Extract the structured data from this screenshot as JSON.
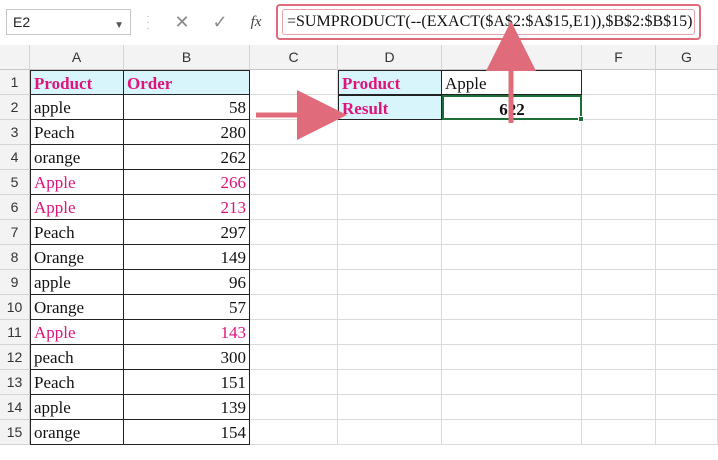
{
  "name_box": "E2",
  "formula": "=SUMPRODUCT(--(EXACT($A$2:$A$15,E1)),$B$2:$B$15)",
  "fx_label": "fx",
  "cancel_icon": "close-icon",
  "enter_icon": "check-icon",
  "columns": [
    "A",
    "B",
    "C",
    "D",
    "E",
    "F",
    "G"
  ],
  "rows": [
    "1",
    "2",
    "3",
    "4",
    "5",
    "6",
    "7",
    "8",
    "9",
    "10",
    "11",
    "12",
    "13",
    "14",
    "15"
  ],
  "table": [
    {
      "product": "Product",
      "order": "Order"
    },
    {
      "product": "apple",
      "order": "58"
    },
    {
      "product": "Peach",
      "order": "280"
    },
    {
      "product": "orange",
      "order": "262"
    },
    {
      "product": "Apple",
      "order": "266"
    },
    {
      "product": "Apple",
      "order": "213"
    },
    {
      "product": "Peach",
      "order": "297"
    },
    {
      "product": "Orange",
      "order": "149"
    },
    {
      "product": "apple",
      "order": "96"
    },
    {
      "product": "Orange",
      "order": "57"
    },
    {
      "product": "Apple",
      "order": "143"
    },
    {
      "product": "peach",
      "order": "300"
    },
    {
      "product": "Peach",
      "order": "151"
    },
    {
      "product": "apple",
      "order": "139"
    },
    {
      "product": "orange",
      "order": "154"
    }
  ],
  "lookup": {
    "label1": "Product",
    "value1": "Apple",
    "label2": "Result",
    "value2": "622"
  },
  "colors": {
    "accent_pink": "#e0127b",
    "header_fill": "#d7f5fb",
    "arrow": "#e06c7b",
    "selection": "#1e6e3a"
  }
}
